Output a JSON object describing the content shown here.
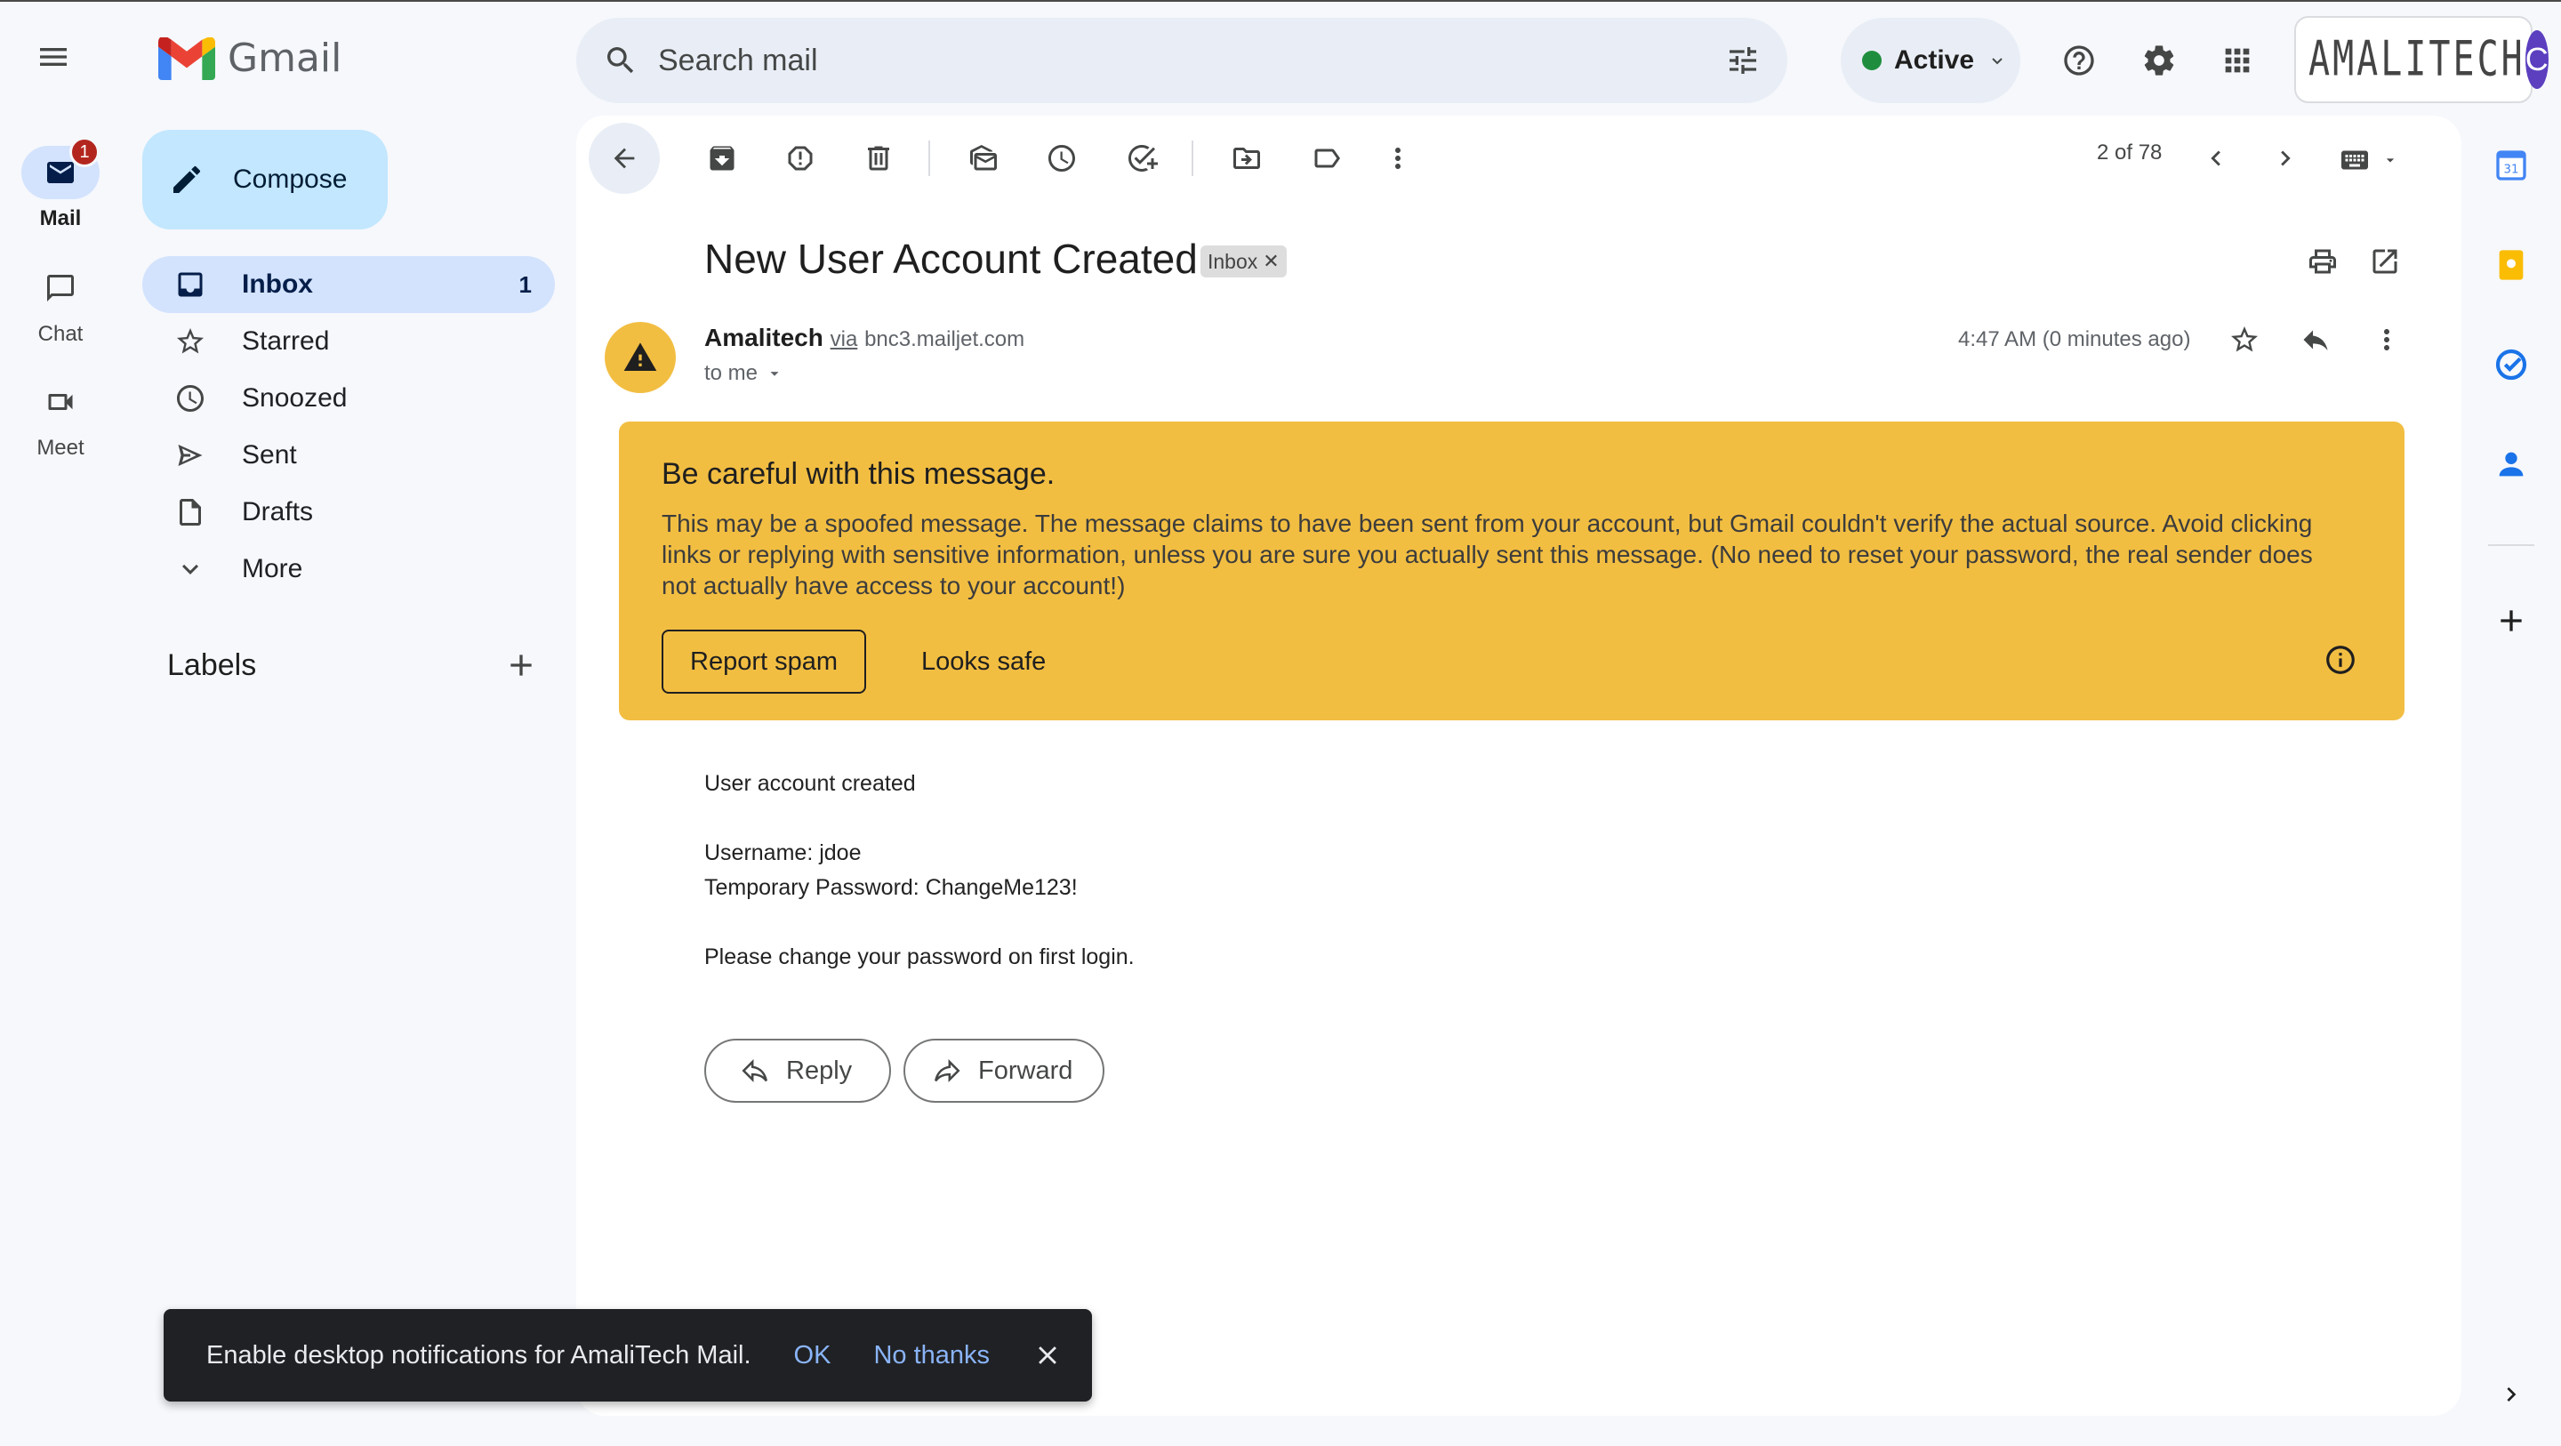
{
  "app": {
    "name": "Gmail"
  },
  "search": {
    "placeholder": "Search mail"
  },
  "status": {
    "label": "Active"
  },
  "account": {
    "org_name": "AMALITECH",
    "avatar_initial": "C"
  },
  "rail": {
    "mail": {
      "label": "Mail",
      "badge": "1"
    },
    "chat": {
      "label": "Chat"
    },
    "meet": {
      "label": "Meet"
    }
  },
  "sidebar": {
    "compose_label": "Compose",
    "items": [
      {
        "label": "Inbox",
        "count": "1",
        "icon": "inbox-icon",
        "active": true
      },
      {
        "label": "Starred",
        "icon": "star-icon"
      },
      {
        "label": "Snoozed",
        "icon": "clock-icon"
      },
      {
        "label": "Sent",
        "icon": "send-icon"
      },
      {
        "label": "Drafts",
        "icon": "draft-icon"
      },
      {
        "label": "More",
        "icon": "chevron-down-icon"
      }
    ],
    "labels_title": "Labels"
  },
  "toolbar": {
    "pager": "2 of 78"
  },
  "email": {
    "subject": "New User Account Created",
    "chip": "Inbox",
    "sender_name": "Amalitech",
    "via": "via",
    "sender_domain": "bnc3.mailjet.com",
    "to": "to me",
    "time": "4:47 AM (0 minutes ago)",
    "body": [
      "User account created",
      "",
      "Username: jdoe",
      "Temporary Password: ChangeMe123!",
      "",
      "Please change your password on first login."
    ]
  },
  "warning": {
    "title": "Be careful with this message.",
    "body": "This may be a spoofed message. The message claims to have been sent from your account, but Gmail couldn't verify the actual source. Avoid clicking links or replying with sensitive information, unless you are sure you actually sent this message. (No need to reset your password, the real sender does not actually have access to your account!)",
    "report_label": "Report spam",
    "safe_label": "Looks safe",
    "color": "#f2be42"
  },
  "actions": {
    "reply_label": "Reply",
    "forward_label": "Forward"
  },
  "snackbar": {
    "text": "Enable desktop notifications for AmaliTech Mail.",
    "ok_label": "OK",
    "dismiss_label": "No thanks"
  },
  "colors": {
    "accent": "#0b57d0",
    "compose_bg": "#c2e7ff",
    "active_nav": "#d3e3fd",
    "badge": "#b3261e"
  }
}
